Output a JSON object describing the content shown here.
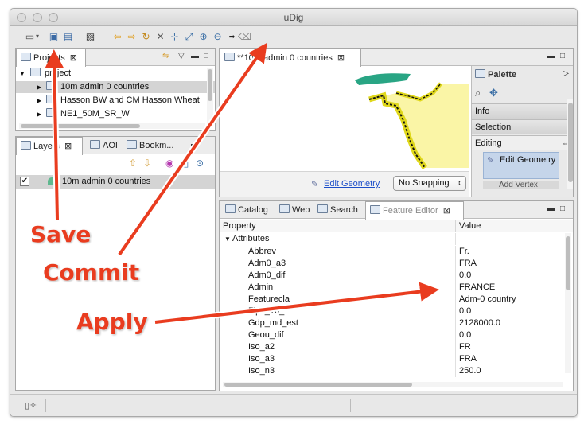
{
  "window": {
    "title": "uDig"
  },
  "projects": {
    "tab_label": "Projects",
    "tree": [
      {
        "label": "project",
        "level": 0,
        "expanded": true
      },
      {
        "label": "10m admin 0 countries",
        "level": 1,
        "selected": true
      },
      {
        "label": "Hasson BW and CM Hasson Wheat",
        "level": 1
      },
      {
        "label": "NE1_50M_SR_W",
        "level": 1
      }
    ]
  },
  "layers": {
    "tabs": [
      "Layers",
      "AOI",
      "Bookm..."
    ],
    "items": [
      {
        "label": "10m admin 0 countries",
        "checked": true
      }
    ]
  },
  "map": {
    "tab_label": "10m admin 0 countries",
    "tab_prefix": "**",
    "edit_geometry_link": "Edit Geometry",
    "snapping": {
      "value": "No Snapping"
    }
  },
  "palette": {
    "title": "Palette",
    "sections": [
      "Info",
      "Selection",
      "Editing"
    ],
    "tools": [
      {
        "label": "Edit Geometry"
      },
      {
        "label": "Add Vertex"
      }
    ]
  },
  "bottom_tabs": [
    "Catalog",
    "Web",
    "Search",
    "Feature Editor"
  ],
  "feature_editor": {
    "headers": [
      "Property",
      "Value"
    ],
    "group": "Attributes",
    "rows": [
      [
        "Abbrev",
        "Fr."
      ],
      [
        "Adm0_a3",
        "FRA"
      ],
      [
        "Adm0_dif",
        "0.0"
      ],
      [
        "Admin",
        "FRANCE"
      ],
      [
        "Featurecla",
        "Adm-0 country"
      ],
      [
        "Fips_10_",
        "0.0"
      ],
      [
        "Gdp_md_est",
        "2128000.0"
      ],
      [
        "Geou_dif",
        "0.0"
      ],
      [
        "Iso_a2",
        "FR"
      ],
      [
        "Iso_a3",
        "FRA"
      ],
      [
        "Iso_n3",
        "250.0"
      ]
    ]
  },
  "annotations": {
    "save": "Save",
    "commit": "Commit",
    "apply": "Apply"
  },
  "colors": {
    "arrow": "#e93c1f",
    "land": "#faf5a6",
    "border": "#e0d81c",
    "water": "#29a584",
    "selection": "#c5d5ea"
  }
}
